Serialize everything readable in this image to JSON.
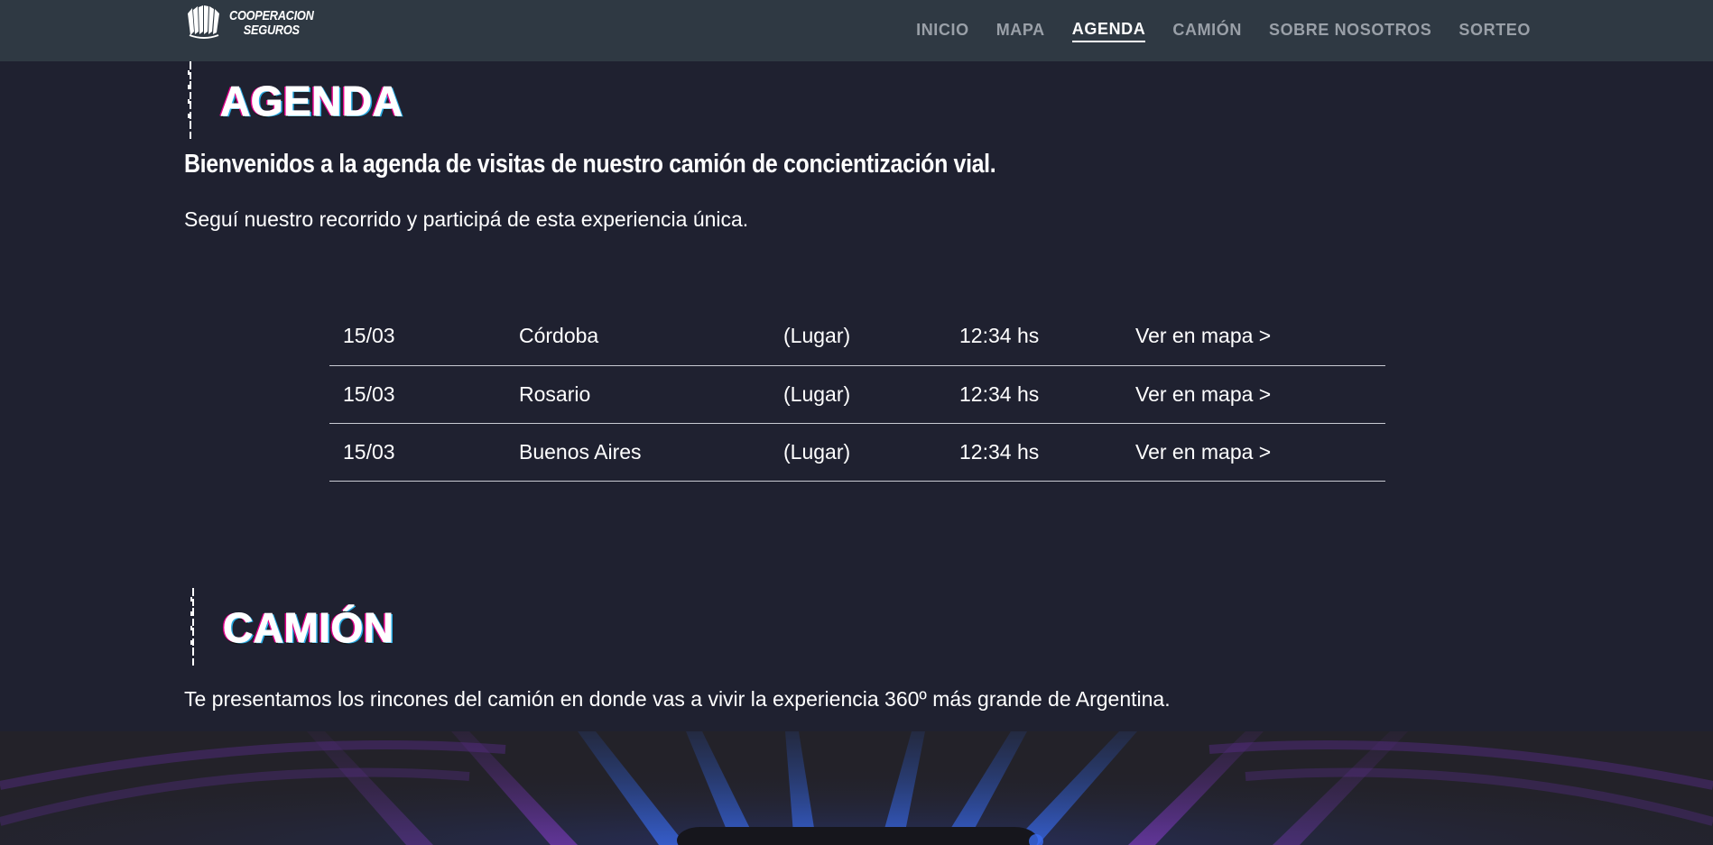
{
  "brand": {
    "logo_line1": "COOPERACION",
    "logo_line2": "SEGUROS",
    "logo_icon": "accordion-fan-icon"
  },
  "nav": {
    "items": [
      {
        "label": "INICIO",
        "active": false
      },
      {
        "label": "MAPA",
        "active": false
      },
      {
        "label": "AGENDA",
        "active": true
      },
      {
        "label": "CAMIÓN",
        "active": false
      },
      {
        "label": "SOBRE NOSOTROS",
        "active": false
      },
      {
        "label": "SORTEO",
        "active": false
      }
    ]
  },
  "agenda": {
    "heading": "AGENDA",
    "title": "Bienvenidos a la agenda de visitas de nuestro camión de concientización vial.",
    "subtitle": "Seguí nuestro recorrido y participá de esta experiencia única.",
    "rows": [
      {
        "date": "15/03",
        "city": "Córdoba",
        "place": "(Lugar)",
        "time": "12:34 hs",
        "link": "Ver en mapa >"
      },
      {
        "date": "15/03",
        "city": "Rosario",
        "place": "(Lugar)",
        "time": "12:34 hs",
        "link": "Ver en mapa >"
      },
      {
        "date": "15/03",
        "city": "Buenos Aires",
        "place": "(Lugar)",
        "time": "12:34 hs",
        "link": "Ver en mapa >"
      }
    ]
  },
  "camion": {
    "heading": "CAMIÓN",
    "text": "Te presentamos los rincones del camión en donde vas a vivir la experiencia 360º más grande de Argentina."
  },
  "colors": {
    "page_bg": "#1f2130",
    "navbar_bg": "#2f3943",
    "nav_inactive": "#9aa0a8",
    "glitch_magenta": "#e0008a",
    "glitch_cyan": "#27a9e1"
  }
}
